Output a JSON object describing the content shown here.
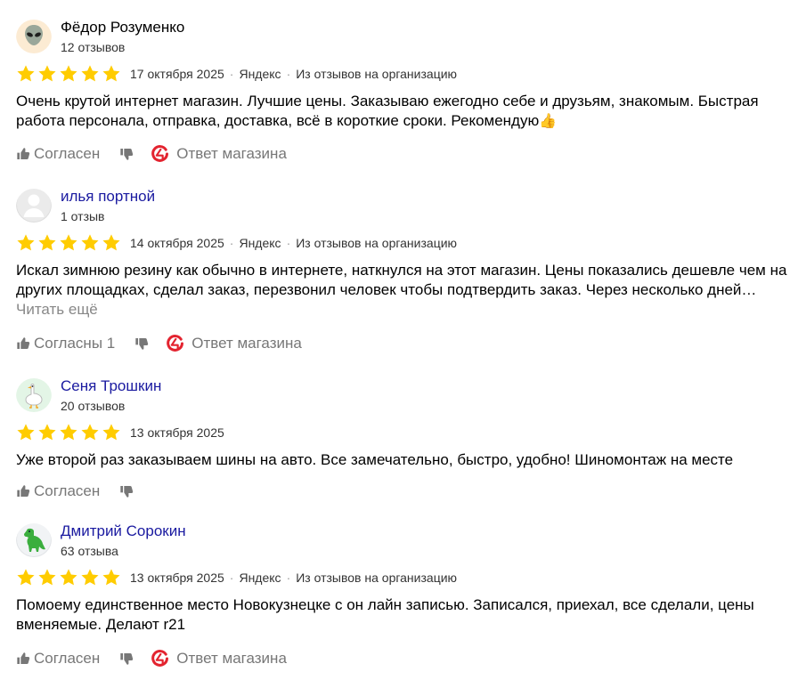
{
  "reviews": [
    {
      "author": "Фёдор Розуменко",
      "reviews_count": "12 отзывов",
      "avatar_icon": "alien-icon",
      "rating": 5,
      "date": "17 октября 2025",
      "source_name": "Яндекс",
      "source_note": "Из отзывов на организацию",
      "text": "Очень крутой интернет магазин. Лучшие цены. Заказываю ежегодно себе и друзьям, знакомым. Быстрая работа персонала, отправка, доставка, всё в короткие сроки. Рекомендую",
      "text_emoji": "👍",
      "read_more": "",
      "like_label": "Согласен",
      "shop_reply_label": "Ответ магазина"
    },
    {
      "author": "илья портной",
      "reviews_count": "1 отзыв",
      "avatar_icon": "default-user-icon",
      "rating": 5,
      "date": "14 октября 2025",
      "source_name": "Яндекс",
      "source_note": "Из отзывов на организацию",
      "text": "Искал зимнюю резину как обычно в интернете, наткнулся на этот магазин. Цены показались дешевле чем на других площадках, сделал заказ, перезвонил человек чтобы подтвердить заказ. Через несколько дней…",
      "text_emoji": "",
      "read_more": "Читать ещё",
      "like_label": "Согласны 1",
      "shop_reply_label": "Ответ магазина"
    },
    {
      "author": "Сеня Трошкин",
      "reviews_count": "20 отзывов",
      "avatar_icon": "goose-icon",
      "rating": 5,
      "date": "13 октября 2025",
      "source_name": "",
      "source_note": "",
      "text": "Уже второй раз заказываем шины на авто. Все замечательно, быстро, удобно! Шиномонтаж на месте",
      "text_emoji": "",
      "read_more": "",
      "like_label": "Согласен",
      "shop_reply_label": ""
    },
    {
      "author": "Дмитрий Сорокин",
      "reviews_count": "63 отзыва",
      "avatar_icon": "dinosaur-icon",
      "rating": 5,
      "date": "13 октября 2025",
      "source_name": "Яндекс",
      "source_note": "Из отзывов на организацию",
      "text": "Помоему единственное место Новокузнецке с он лайн записью. Записался, приехал, все сделали, цены вменяемые. Делают r21",
      "text_emoji": "",
      "read_more": "",
      "like_label": "Согласен",
      "shop_reply_label": "Ответ магазина"
    }
  ],
  "colors": {
    "star": "#FFCC00",
    "author_link": "#1A1AA0",
    "author_plain": "#000000",
    "muted": "#777777",
    "shop_logo_red": "#E3232F",
    "separator": "#999999"
  }
}
